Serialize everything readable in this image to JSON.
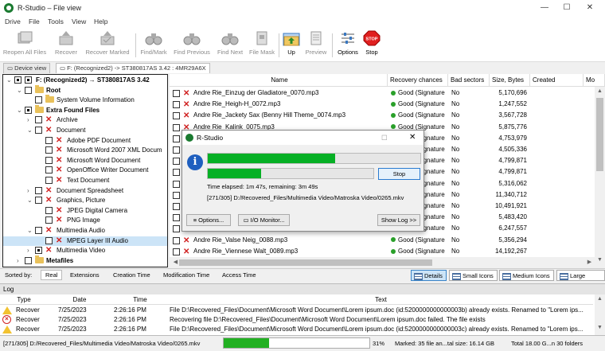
{
  "window": {
    "title": "R-Studio – File view",
    "controls": [
      "—",
      "☐",
      "✕"
    ]
  },
  "menu": [
    "Drive",
    "File",
    "Tools",
    "View",
    "Help"
  ],
  "toolbar": [
    {
      "label": "Reopen All Files",
      "disabled": true
    },
    {
      "label": "Recover",
      "disabled": true
    },
    {
      "label": "Recover Marked",
      "disabled": true
    },
    {
      "label": "Find/Mark",
      "disabled": true
    },
    {
      "label": "Find Previous",
      "disabled": true
    },
    {
      "label": "Find Next",
      "disabled": true
    },
    {
      "label": "File Mask",
      "disabled": true
    },
    {
      "label": "Up",
      "disabled": false
    },
    {
      "label": "Preview",
      "disabled": true
    },
    {
      "label": "Options",
      "disabled": false
    },
    {
      "label": "Stop",
      "disabled": false
    }
  ],
  "tabs": [
    "Device view",
    "F: (Recognized2) -> ST380817AS 3.42 : 4MR29A6X"
  ],
  "tree": [
    {
      "label": "F: (Recognized2) → ST380817AS 3.42",
      "level": 0,
      "type": "drive",
      "bold": true,
      "chev": "⌄",
      "check": "filled"
    },
    {
      "label": "Root",
      "level": 1,
      "type": "folder",
      "bold": true,
      "chev": "⌄",
      "check": "empty"
    },
    {
      "label": "System Volume Information",
      "level": 2,
      "type": "folder",
      "bold": false,
      "chev": "",
      "check": "empty"
    },
    {
      "label": "Extra Found Files",
      "level": 1,
      "type": "folder",
      "bold": true,
      "chev": "⌄",
      "check": "filled"
    },
    {
      "label": "Archive",
      "level": 2,
      "type": "x",
      "bold": false,
      "chev": "›",
      "check": "empty"
    },
    {
      "label": "Document",
      "level": 2,
      "type": "x",
      "bold": false,
      "chev": "⌄",
      "check": "empty"
    },
    {
      "label": "Adobe PDF Document",
      "level": 3,
      "type": "x",
      "bold": false,
      "chev": "",
      "check": "empty"
    },
    {
      "label": "Microsoft Word 2007 XML Docum",
      "level": 3,
      "type": "x",
      "bold": false,
      "chev": "",
      "check": "empty"
    },
    {
      "label": "Microsoft Word Document",
      "level": 3,
      "type": "x",
      "bold": false,
      "chev": "",
      "check": "empty"
    },
    {
      "label": "OpenOffice Writer Document",
      "level": 3,
      "type": "x",
      "bold": false,
      "chev": "",
      "check": "empty"
    },
    {
      "label": "Text Document",
      "level": 3,
      "type": "x",
      "bold": false,
      "chev": "",
      "check": "empty"
    },
    {
      "label": "Document Spreadsheet",
      "level": 2,
      "type": "x",
      "bold": false,
      "chev": "›",
      "check": "empty"
    },
    {
      "label": "Graphics, Picture",
      "level": 2,
      "type": "x",
      "bold": false,
      "chev": "⌄",
      "check": "empty"
    },
    {
      "label": "JPEG Digital Camera",
      "level": 3,
      "type": "x",
      "bold": false,
      "chev": "",
      "check": "empty"
    },
    {
      "label": "PNG Image",
      "level": 3,
      "type": "x",
      "bold": false,
      "chev": "",
      "check": "empty"
    },
    {
      "label": "Multimedia Audio",
      "level": 2,
      "type": "x",
      "bold": false,
      "chev": "⌄",
      "check": "empty"
    },
    {
      "label": "MPEG Layer III Audio",
      "level": 3,
      "type": "x",
      "bold": false,
      "chev": "",
      "check": "empty",
      "selected": true
    },
    {
      "label": "Multimedia Video",
      "level": 2,
      "type": "x",
      "bold": false,
      "chev": "›",
      "check": "filled"
    },
    {
      "label": "Metafiles",
      "level": 1,
      "type": "folder",
      "bold": true,
      "chev": "›",
      "check": "empty"
    }
  ],
  "file_columns": [
    "Name",
    "Recovery chances",
    "Bad sectors",
    "Size, Bytes",
    "Created",
    "Mo"
  ],
  "files": [
    {
      "name": "Andre Rie_Einzug der Gladiatore_0070.mp3",
      "chance": "Good (Signature",
      "bad": "No",
      "size": "5,170,696"
    },
    {
      "name": "Andre Rie_Heigh-H_0072.mp3",
      "chance": "Good (Signature",
      "bad": "No",
      "size": "1,247,552"
    },
    {
      "name": "Andre Rie_Jackety Sax (Benny Hill Theme_0074.mp3",
      "chance": "Good (Signature",
      "bad": "No",
      "size": "3,567,728"
    },
    {
      "name": "Andre Rie_Kalink_0075.mp3",
      "chance": "Good (Signature",
      "bad": "No",
      "size": "5,875,776"
    },
    {
      "name": "",
      "chance": "Good (Signature",
      "bad": "No",
      "size": "4,753,979"
    },
    {
      "name": "",
      "chance": "Good (Signature",
      "bad": "No",
      "size": "4,505,336"
    },
    {
      "name": "",
      "chance": "Good (Signature",
      "bad": "No",
      "size": "4,799,871"
    },
    {
      "name": "",
      "chance": "Good (Signature",
      "bad": "No",
      "size": "4,799,871"
    },
    {
      "name": "",
      "chance": "Good (Signature",
      "bad": "No",
      "size": "5,316,062"
    },
    {
      "name": "",
      "chance": "Good (Signature",
      "bad": "No",
      "size": "11,340,712"
    },
    {
      "name": "",
      "chance": "Good (Signature",
      "bad": "No",
      "size": "10,491,921"
    },
    {
      "name": "",
      "chance": "Good (Signature",
      "bad": "No",
      "size": "5,483,420"
    },
    {
      "name": "",
      "chance": "Good (Signature",
      "bad": "No",
      "size": "6,247,557"
    },
    {
      "name": "Andre Rie_Valse Neig_0088.mp3",
      "chance": "Good (Signature",
      "bad": "No",
      "size": "5,356,294"
    },
    {
      "name": "Andre Rie_Viennese Walt_0089.mp3",
      "chance": "Good (Signature",
      "bad": "No",
      "size": "14,192,267"
    }
  ],
  "sort_bar": {
    "label": "Sorted by:",
    "options": [
      "Real",
      "Extensions",
      "Creation Time",
      "Modification Time",
      "Access Time"
    ],
    "views": [
      "Details",
      "Small Icons",
      "Medium Icons",
      "Large Icons"
    ]
  },
  "log": {
    "title": "Log",
    "columns": [
      "Type",
      "Date",
      "Time",
      "Text"
    ],
    "rows": [
      {
        "kind": "warn",
        "type": "Recover",
        "date": "7/25/2023",
        "time": "2:26:16 PM",
        "text": "File D:\\Recovered_Files\\Document\\Microsoft Word Document\\Lorem ipsum.doc (id:5200000000000003b) already exists. Renamed to \"Lorem ips..."
      },
      {
        "kind": "error",
        "type": "Recover",
        "date": "7/25/2023",
        "time": "2:26:16 PM",
        "text": "Recovering file D:\\Recovered_Files\\Document\\Microsoft Word Document\\Lorem ipsum.doc failed. The file exists"
      },
      {
        "kind": "warn",
        "type": "Recover",
        "date": "7/25/2023",
        "time": "2:26:16 PM",
        "text": "File D:\\Recovered_Files\\Document\\Microsoft Word Document\\Lorem ipsum.doc (id:5200000000000003c) already exists. Renamed to \"Lorem ips..."
      }
    ]
  },
  "status": {
    "path": "[271/305] D:/Recovered_Files/Multimedia Video/Matroska Video/0265.mkv",
    "progress": 0.31,
    "percent": "31%",
    "marked": "Marked: 35 file an...tal size: 16.14 GB",
    "total": "Total 18.00 G...n 30 folders"
  },
  "dialog": {
    "title": "R-Studio",
    "progress_overall": 0.6,
    "progress_file": 0.32,
    "stop_label": "Stop",
    "time_text": "Time elapsed: 1m 47s, remaining: 3m 49s",
    "file_text": "[271/305] D:/Recovered_Files/Multimedia Video/Matroska Video/0265.mkv",
    "options_label": "Options...",
    "io_label": "I/O Monitor...",
    "showlog_label": "Show Log >>"
  }
}
